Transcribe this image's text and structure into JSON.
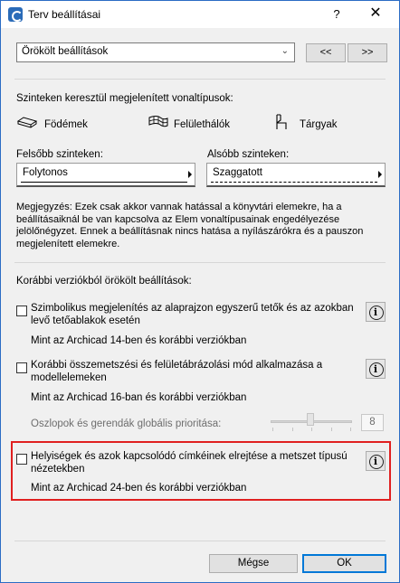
{
  "window": {
    "title": "Terv beállításai",
    "help_label": "?",
    "close_label": "✕"
  },
  "preset": {
    "selected": "Örökölt beállítások",
    "prev_label": "<<",
    "next_label": ">>"
  },
  "linetypes": {
    "heading": "Szinteken keresztül megjelenített vonaltípusok:",
    "items": [
      {
        "label": "Födémek",
        "icon": "slab-icon"
      },
      {
        "label": "Felülethálók",
        "icon": "mesh-icon"
      },
      {
        "label": "Tárgyak",
        "icon": "chair-icon"
      }
    ],
    "upper": {
      "label": "Felsőbb szinteken:",
      "value": "Folytonos"
    },
    "lower": {
      "label": "Alsóbb szinteken:",
      "value": "Szaggatott"
    }
  },
  "note": "Megjegyzés: Ezek csak akkor vannak hatással a könyvtári elemekre, ha a beállításaiknál be van kapcsolva az Elem vonaltípusainak engedélyezése jelölőnégyzet. Ennek a beállításnak nincs hatása a nyílászárókra és a pauszon megjelenített elemekre.",
  "legacy": {
    "heading": "Korábbi verziókból örökölt beállítások:",
    "options": [
      {
        "label": "Szimbolikus megjelenítés az alaprajzon egyszerű tetők és az azokban levő tetőablakok esetén",
        "sub": "Mint az Archicad 14-ben és korábbi verziókban",
        "checked": false
      },
      {
        "label": "Korábbi összemetszési és felületábrázolási mód alkalmazása a modellelemeken",
        "sub": "Mint az Archicad 16-ban és korábbi verziókban",
        "checked": false
      },
      {
        "label": "Helyiségek és azok kapcsolódó címkéinek elrejtése a metszet típusú nézetekben",
        "sub": "Mint az Archicad 24-ben és korábbi verziókban",
        "checked": false
      }
    ],
    "priority": {
      "label": "Oszlopok és gerendák globális prioritása:",
      "value": "8"
    },
    "info_label": "i"
  },
  "footer": {
    "cancel_label": "Mégse",
    "ok_label": "OK"
  },
  "colors": {
    "highlight": "#e02020",
    "accent": "#0078d7",
    "window_border": "#2b6cc4"
  }
}
